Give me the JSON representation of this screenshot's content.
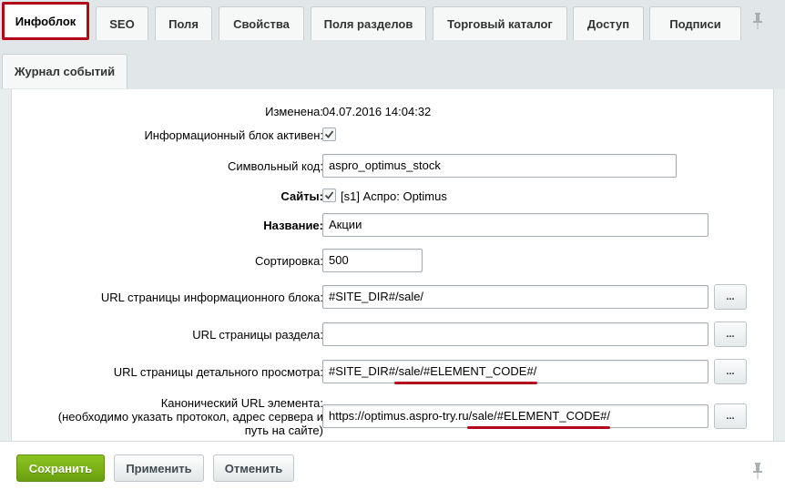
{
  "tabs": {
    "row1": [
      "Инфоблок",
      "SEO",
      "Поля",
      "Свойства",
      "Поля разделов",
      "Торговый каталог",
      "Доступ",
      "Подписи"
    ],
    "row2": [
      "Журнал событий"
    ],
    "active": "Инфоблок"
  },
  "form": {
    "modified_label": "Изменена:",
    "modified_value": "04.07.2016 14:04:32",
    "active_label": "Информационный блок активен:",
    "active_checked": true,
    "code_label": "Символьный код:",
    "code_value": "aspro_optimus_stock",
    "sites_label": "Сайты:",
    "sites_value": "[s1] Аспро: Optimus",
    "name_label": "Название:",
    "name_value": "Акции",
    "sort_label": "Сортировка:",
    "sort_value": "500",
    "list_url_label": "URL страницы информационного блока:",
    "list_url_value": "#SITE_DIR#/sale/",
    "section_url_label": "URL страницы раздела:",
    "section_url_value": "",
    "detail_url_label": "URL страницы детального просмотра:",
    "detail_url_value": "#SITE_DIR#/sale/#ELEMENT_CODE#/",
    "canonical_label_line1": "Канонический URL элемента:",
    "canonical_label_line2": "(необходимо указать протокол, адрес сервера и",
    "canonical_label_line3": "путь на сайте)",
    "canonical_value": "https://optimus.aspro-try.ru/sale/#ELEMENT_CODE#/",
    "dots_label": "..."
  },
  "footer": {
    "save_label": "Сохранить",
    "apply_label": "Применить",
    "cancel_label": "Отменить"
  },
  "colors": {
    "highlight": "#b3081a",
    "save_button": "#79b316"
  },
  "icons": [
    "pin-icon",
    "checkmark-icon"
  ]
}
